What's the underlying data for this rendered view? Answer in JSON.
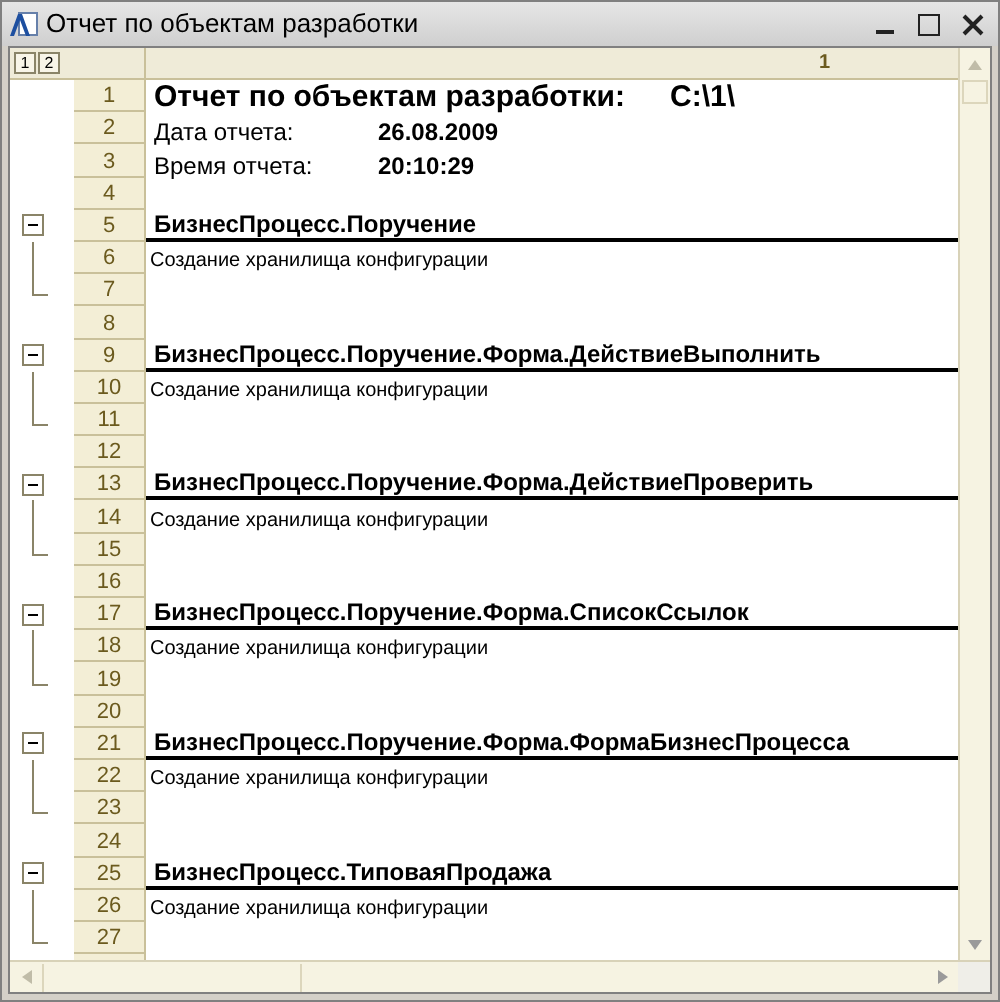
{
  "window": {
    "title": "Отчет по объектам разработки"
  },
  "level_buttons": [
    "1",
    "2"
  ],
  "column_header": "1",
  "rows": [
    {
      "number": "1",
      "kind": "title",
      "text": "Отчет по объектам разработки:",
      "value": "C:\\1\\"
    },
    {
      "number": "2",
      "kind": "field",
      "text": "Дата отчета:",
      "value": "26.08.2009"
    },
    {
      "number": "3",
      "kind": "field",
      "text": "Время отчета:",
      "value": "20:10:29"
    },
    {
      "number": "4",
      "kind": "blank"
    },
    {
      "number": "5",
      "kind": "group",
      "text": "БизнесПроцесс.Поручение",
      "expanded": true,
      "children": [
        {
          "number": "6",
          "kind": "note",
          "text": "Создание хранилища конфигурации"
        },
        {
          "number": "7",
          "kind": "blank"
        }
      ]
    },
    {
      "number": "8",
      "kind": "blank"
    },
    {
      "number": "9",
      "kind": "group",
      "text": "БизнесПроцесс.Поручение.Форма.ДействиеВыполнить",
      "expanded": true,
      "children": [
        {
          "number": "10",
          "kind": "note",
          "text": "Создание хранилища конфигурации"
        },
        {
          "number": "11",
          "kind": "blank"
        }
      ]
    },
    {
      "number": "12",
      "kind": "blank"
    },
    {
      "number": "13",
      "kind": "group",
      "text": "БизнесПроцесс.Поручение.Форма.ДействиеПроверить",
      "expanded": true,
      "children": [
        {
          "number": "14",
          "kind": "note",
          "text": "Создание хранилища конфигурации"
        },
        {
          "number": "15",
          "kind": "blank"
        }
      ]
    },
    {
      "number": "16",
      "kind": "blank"
    },
    {
      "number": "17",
      "kind": "group",
      "text": "БизнесПроцесс.Поручение.Форма.СписокСсылок",
      "expanded": true,
      "children": [
        {
          "number": "18",
          "kind": "note",
          "text": "Создание хранилища конфигурации"
        },
        {
          "number": "19",
          "kind": "blank"
        }
      ]
    },
    {
      "number": "20",
      "kind": "blank"
    },
    {
      "number": "21",
      "kind": "group",
      "text": "БизнесПроцесс.Поручение.Форма.ФормаБизнесПроцесса",
      "expanded": true,
      "children": [
        {
          "number": "22",
          "kind": "note",
          "text": "Создание хранилища конфигурации"
        },
        {
          "number": "23",
          "kind": "blank"
        }
      ]
    },
    {
      "number": "24",
      "kind": "blank"
    },
    {
      "number": "25",
      "kind": "group",
      "text": "БизнесПроцесс.ТиповаяПродажа",
      "expanded": true,
      "children": [
        {
          "number": "26",
          "kind": "note",
          "text": "Создание хранилища конфигурации"
        },
        {
          "number": "27",
          "kind": "blank"
        }
      ]
    }
  ]
}
